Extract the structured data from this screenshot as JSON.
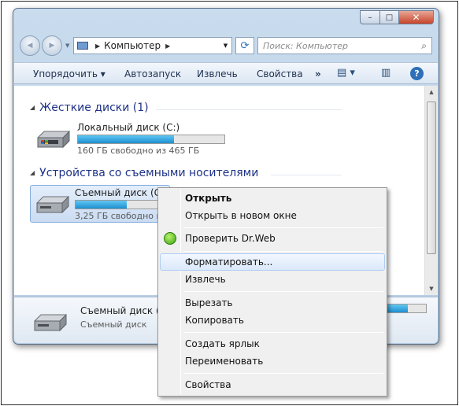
{
  "window": {
    "controls": {
      "minimize": "–",
      "maximize": "□",
      "close": "✕"
    }
  },
  "nav": {
    "back_icon": "◀",
    "forward_icon": "▶",
    "breadcrumb": "Компьютер",
    "refresh_icon": "⟳",
    "search_placeholder": "Поиск: Компьютер",
    "search_icon": "⌕"
  },
  "toolbar": {
    "organize": "Упорядочить ▾",
    "autoplay": "Автозапуск",
    "eject": "Извлечь",
    "properties": "Свойства",
    "more": "»",
    "views_icon": "▤ ▾",
    "pane_icon": "▥",
    "help_icon": "?"
  },
  "groups": [
    {
      "title": "Жесткие диски (1)"
    },
    {
      "title": "Устройства со съемными носителями"
    }
  ],
  "drives": [
    {
      "name": "Локальный диск (C:)",
      "free": "160 ГБ свободно из 465 ГБ",
      "used_fraction": 0.656
    },
    {
      "name": "Съемный диск (G:)",
      "free": "3,25 ГБ свободно из",
      "used_fraction": 0.55
    }
  ],
  "details": {
    "name": "Съемный диск (G",
    "type": "Съемный диск",
    "used_fraction": 0.55
  },
  "context_menu": {
    "open": "Открыть",
    "open_new_window": "Открыть в новом окне",
    "check_drweb": "Проверить Dr.Web",
    "format": "Форматировать...",
    "eject": "Извлечь",
    "cut": "Вырезать",
    "copy": "Копировать",
    "create_shortcut": "Создать ярлык",
    "rename": "Переименовать",
    "properties": "Свойства"
  },
  "colors": {
    "accent_blue": "#1f8fd0",
    "hover_border": "#aeccf1",
    "group_heading": "#1e3287"
  }
}
